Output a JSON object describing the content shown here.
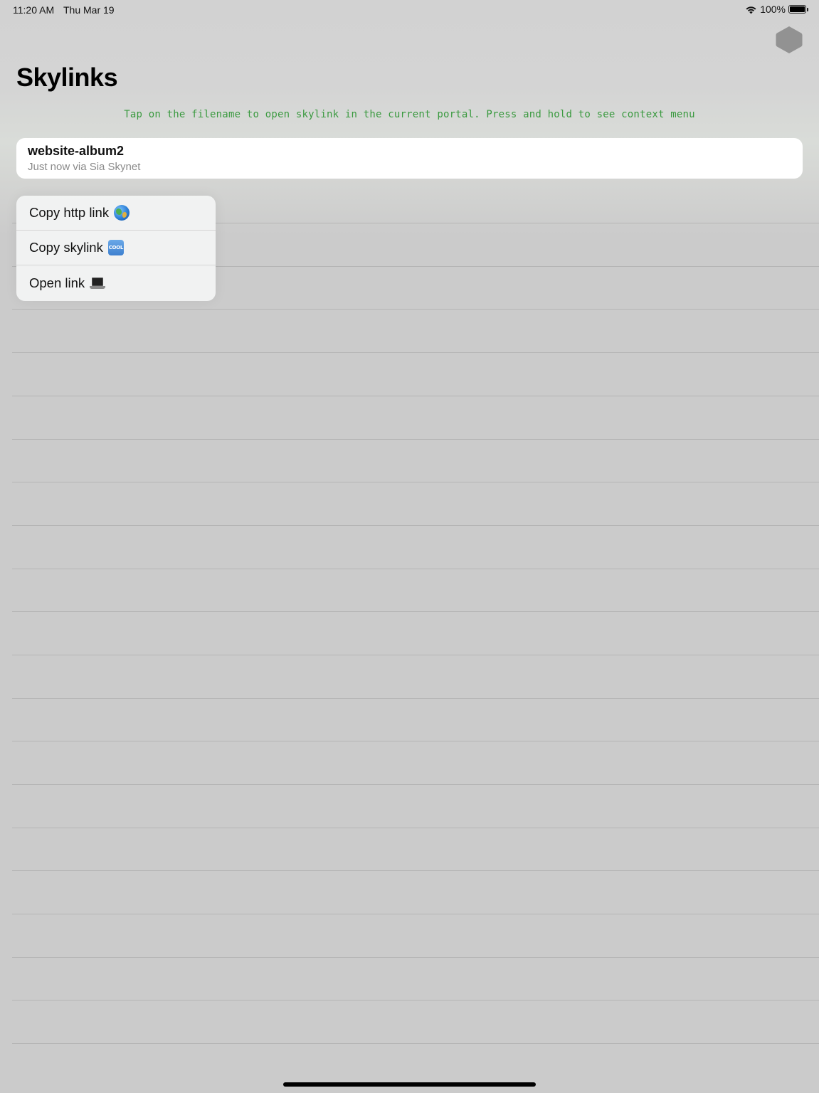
{
  "status_bar": {
    "time": "11:20 AM",
    "date": "Thu Mar 19",
    "battery_percent": "100%",
    "wifi_icon": "wifi-icon",
    "battery_icon": "battery-icon"
  },
  "header": {
    "title": "Skylinks",
    "settings_icon": "hexagon-icon"
  },
  "hint": {
    "text": "Tap on the filename to open skylink in the current portal. Press and hold to see context menu",
    "color": "#3a9a3f"
  },
  "files": [
    {
      "name": "website-album2",
      "meta": "Just now via Sia Skynet"
    }
  ],
  "context_menu": {
    "items": [
      {
        "label": "Copy http link",
        "icon": "globe-icon"
      },
      {
        "label": "Copy skylink",
        "icon": "cool-icon"
      },
      {
        "label": "Open link",
        "icon": "laptop-icon"
      }
    ]
  }
}
